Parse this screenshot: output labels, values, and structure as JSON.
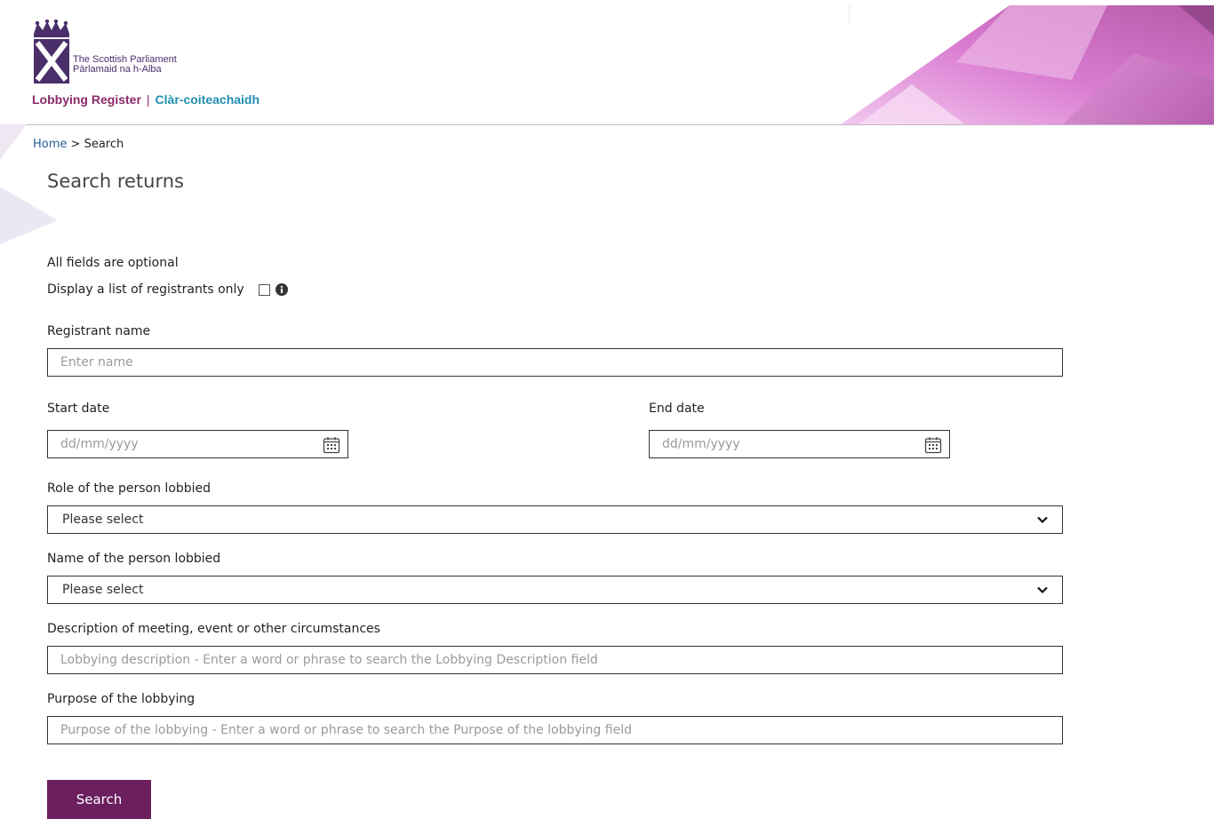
{
  "header": {
    "org_name_en": "The Scottish Parliament",
    "org_name_gd": "Pàrlamaid na h-Alba",
    "register_en": "Lobbying Register",
    "register_sep": "|",
    "register_gd": "Clàr-coiteachaidh"
  },
  "breadcrumb": {
    "home": "Home",
    "separator": " > ",
    "current": "Search"
  },
  "page_title": "Search returns",
  "form": {
    "optional_note": "All fields are optional",
    "registrants_only_label": "Display a list of registrants only",
    "registrant_name": {
      "label": "Registrant name",
      "placeholder": "Enter name"
    },
    "start_date": {
      "label": "Start date",
      "placeholder": "dd/mm/yyyy"
    },
    "end_date": {
      "label": "End date",
      "placeholder": "dd/mm/yyyy"
    },
    "role_lobbied": {
      "label": "Role of the person lobbied",
      "selected": "Please select"
    },
    "name_lobbied": {
      "label": "Name of the person lobbied",
      "selected": "Please select"
    },
    "description": {
      "label": "Description of meeting, event or other circumstances",
      "placeholder": "Lobbying description - Enter a word or phrase to search the Lobbying Description field"
    },
    "purpose": {
      "label": "Purpose of the lobbying",
      "placeholder": "Purpose of the lobbying - Enter a word or phrase to search the Purpose of the lobbying field"
    },
    "search_button": "Search"
  },
  "colors": {
    "brand_purple": "#6b1f5e",
    "link_blue": "#2b5c9b",
    "accent_blue": "#1f8fb0"
  }
}
